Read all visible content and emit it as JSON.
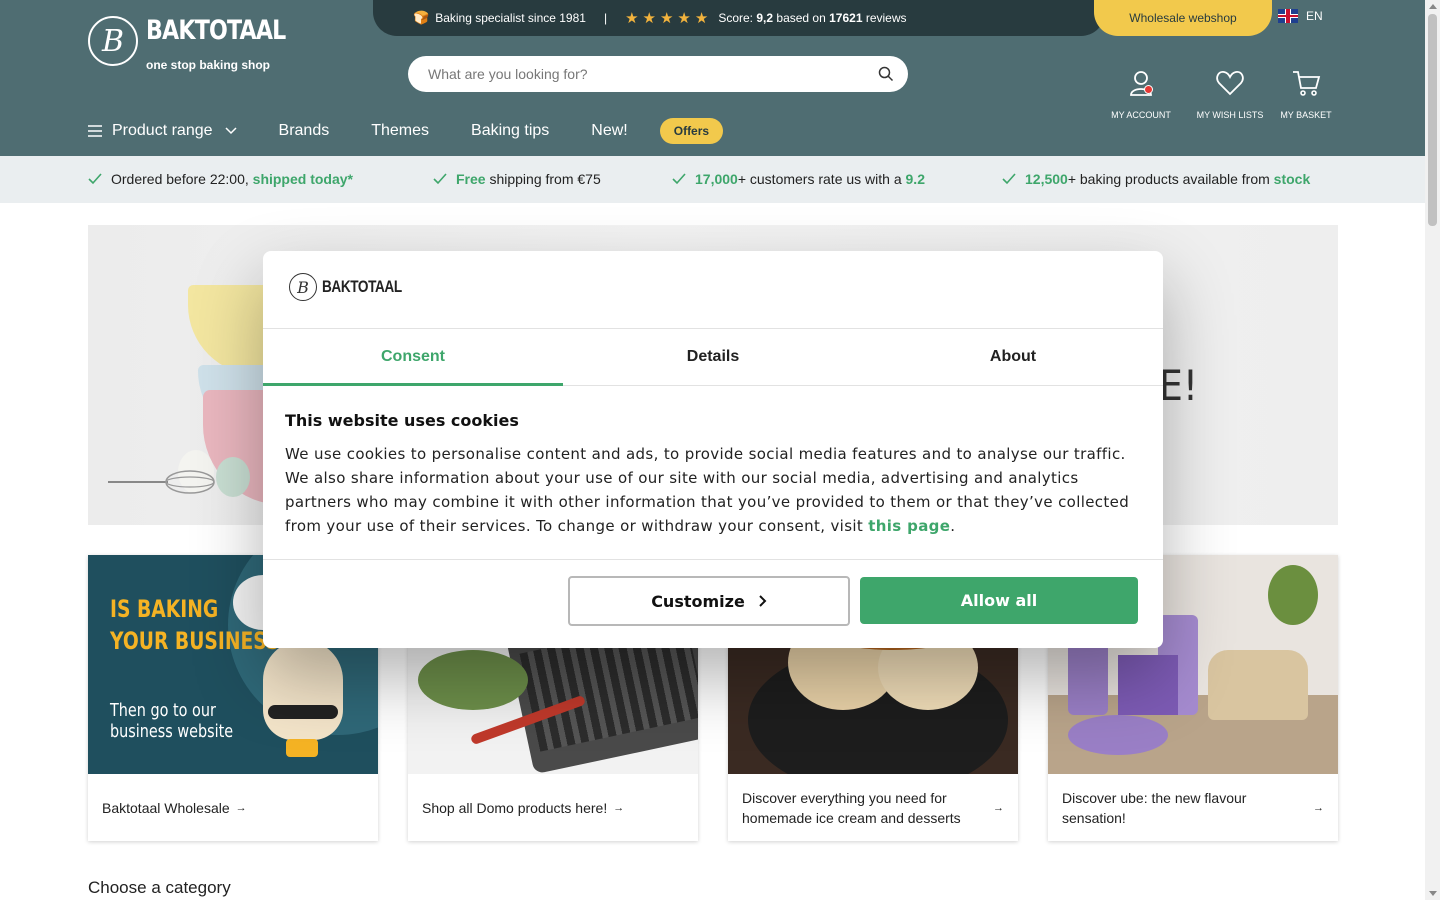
{
  "brand": {
    "name": "BAKTOTAAL",
    "tagline": "one stop baking shop",
    "logo_letter": "B"
  },
  "topbar": {
    "specialist": "Baking specialist since 1981",
    "separator": "|",
    "rating_stars": "★★★★★",
    "score_prefix": "Score:",
    "score": "9,2",
    "based_on": "based on",
    "reviews_count": "17621",
    "reviews_suffix": "reviews",
    "wholesale_label": "Wholesale webshop",
    "language": "EN"
  },
  "search": {
    "placeholder": "What are you looking for?"
  },
  "account": {
    "my_account": "MY ACCOUNT",
    "wish_lists": "MY WISH LISTS",
    "basket": "MY BASKET"
  },
  "nav": {
    "product_range": "Product range",
    "brands": "Brands",
    "themes": "Themes",
    "baking_tips": "Baking tips",
    "new": "New!",
    "offers": "Offers"
  },
  "usp": {
    "u1_text": "Ordered before 22:00, ",
    "u1_green": "shipped today*",
    "u2_green": "Free",
    "u2_text": " shipping from €75",
    "u3_green": "17,000",
    "u3_text": "+ customers rate us with a ",
    "u3_green2": "9.2",
    "u4_green": "12,500",
    "u4_text": "+ baking products available from ",
    "u4_green2": "stock"
  },
  "hero": {
    "visible_text": "E!"
  },
  "tiles": [
    {
      "caption": "Baktotaal Wholesale",
      "headline_1": "IS BAKING",
      "headline_2": "YOUR BUSINESS?",
      "sub_1": "Then go to our",
      "sub_2": "business website"
    },
    {
      "caption": "Shop all Domo products here!"
    },
    {
      "caption": "Discover everything you need for homemade ice cream and desserts"
    },
    {
      "caption": "Discover ube: the new flavour sensation!"
    }
  ],
  "section": {
    "choose_category": "Choose a category"
  },
  "cookie_dialog": {
    "logo_text": "BAKTOTAAL",
    "tabs": [
      "Consent",
      "Details",
      "About"
    ],
    "title": "This website uses cookies",
    "body": "We use cookies to personalise content and ads, to provide social media features and to analyse our traffic. We also share information about your use of our site with our social media, advertising and analytics partners who may combine it with other information that you’ve provided to them or that they’ve collected from your use of their services. To change or withdraw your consent, visit ",
    "link_text": "this page",
    "body_end": ".",
    "customize_label": "Customize",
    "allow_all_label": "Allow all"
  },
  "colors": {
    "header": "#4f6d72",
    "topbar": "#283b3f",
    "accent_yellow": "#f2c94c",
    "accent_green": "#3ea66b"
  }
}
